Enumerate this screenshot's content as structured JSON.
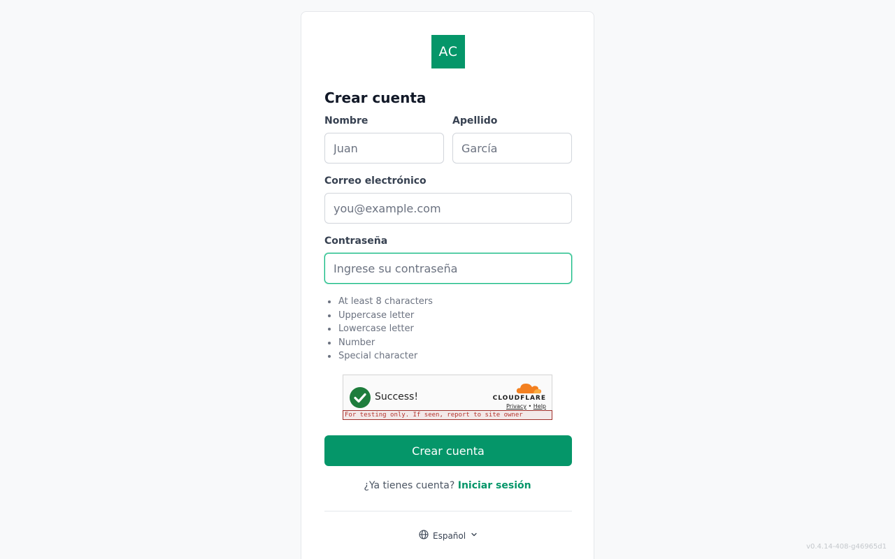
{
  "logo": {
    "text": "AC"
  },
  "form": {
    "title": "Crear cuenta",
    "first_name": {
      "label": "Nombre",
      "placeholder": "Juan"
    },
    "last_name": {
      "label": "Apellido",
      "placeholder": "García"
    },
    "email": {
      "label": "Correo electrónico",
      "placeholder": "you@example.com"
    },
    "password": {
      "label": "Contraseña",
      "placeholder": "Ingrese su contraseña"
    },
    "requirements": [
      "At least 8 characters",
      "Uppercase letter",
      "Lowercase letter",
      "Number",
      "Special character"
    ],
    "submit_label": "Crear cuenta"
  },
  "captcha": {
    "status": "Success!",
    "brand": "CLOUDFLARE",
    "privacy": "Privacy",
    "separator": "•",
    "help": "Help",
    "warning": "For testing only. If seen, report to site owner"
  },
  "signin": {
    "prompt": "¿Ya tienes cuenta?",
    "link": "Iniciar sesión"
  },
  "language": {
    "selected": "Español"
  },
  "version": "v0.4.14-408-g46965d1",
  "colors": {
    "accent": "#059669",
    "captcha_success": "#1e7d3c",
    "cloudflare_orange": "#f38020",
    "warning_red": "#b4322c"
  },
  "icons": {
    "language": "globe-icon",
    "dropdown": "chevron-down-icon",
    "captcha_status": "checkmark-icon",
    "captcha_brand": "cloud-icon"
  }
}
